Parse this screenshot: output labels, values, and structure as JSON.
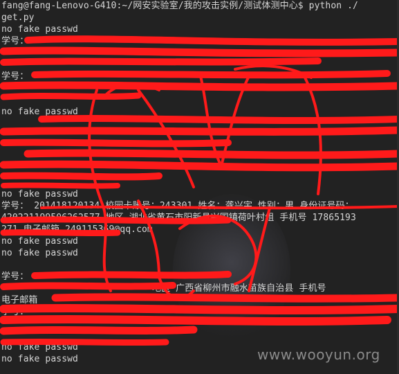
{
  "terminal": {
    "prompt_line1": "fang@fang-Lenovo-G410:~/网安实验室/我的攻击实例/测试体测中心$ python ./",
    "prompt_line2": "get.py",
    "no_fake": "no fake passwd",
    "student_prefix": "学号：",
    "record3_line1": "学号： 201418120134 校园卡账号：243301 姓名：龚兴宇 性别：男 身份证号码：",
    "record3_line2": "420221199506262577 地区 湖北省黄石市阳新县兴国镇荷叶村组 手机号 17865193",
    "record3_line3": "271 电子邮箱 249115369@qq.com",
    "partial_email_label": "电子邮箱",
    "partial_sentence": "地区 广西省柳州市融水苗族自治县 手机号"
  },
  "watermark": "www.wooyun.org",
  "colors": {
    "background": "#222222",
    "text": "#d6d6d6",
    "redaction": "#ff1a1a"
  }
}
